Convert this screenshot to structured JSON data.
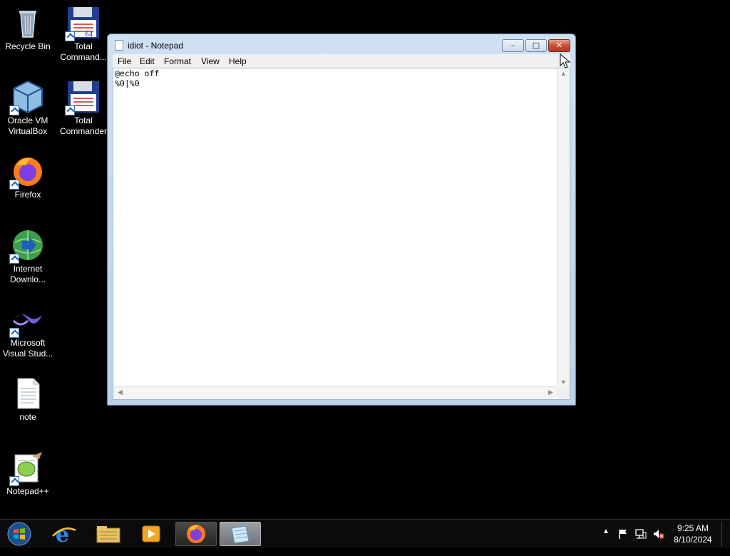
{
  "desktop": {
    "icons": [
      {
        "label": "Recycle Bin"
      },
      {
        "label": "Total Command..."
      },
      {
        "label": "Oracle VM VirtualBox"
      },
      {
        "label": "Total Commander"
      },
      {
        "label": "Firefox"
      },
      {
        "label": "Internet Downlo..."
      },
      {
        "label": "Microsoft Visual Stud..."
      },
      {
        "label": "note"
      },
      {
        "label": "Notepad++"
      }
    ]
  },
  "window": {
    "title": "idiot - Notepad",
    "menu": [
      "File",
      "Edit",
      "Format",
      "View",
      "Help"
    ],
    "content": "@echo off\n%0|%0",
    "buttons": {
      "minimize": "–",
      "maximize": "□",
      "close": "✕"
    }
  },
  "taskbar": {
    "pinned": [
      "start-orb",
      "internet-explorer-icon",
      "file-explorer-icon",
      "media-player-icon",
      "firefox-icon",
      "notepad-icon"
    ],
    "clock": {
      "time": "9:25 AM",
      "date": "8/10/2024"
    },
    "tray_icons": [
      "show-hidden-icons",
      "action-center-flag-icon",
      "network-icon",
      "volume-muted-icon"
    ]
  }
}
